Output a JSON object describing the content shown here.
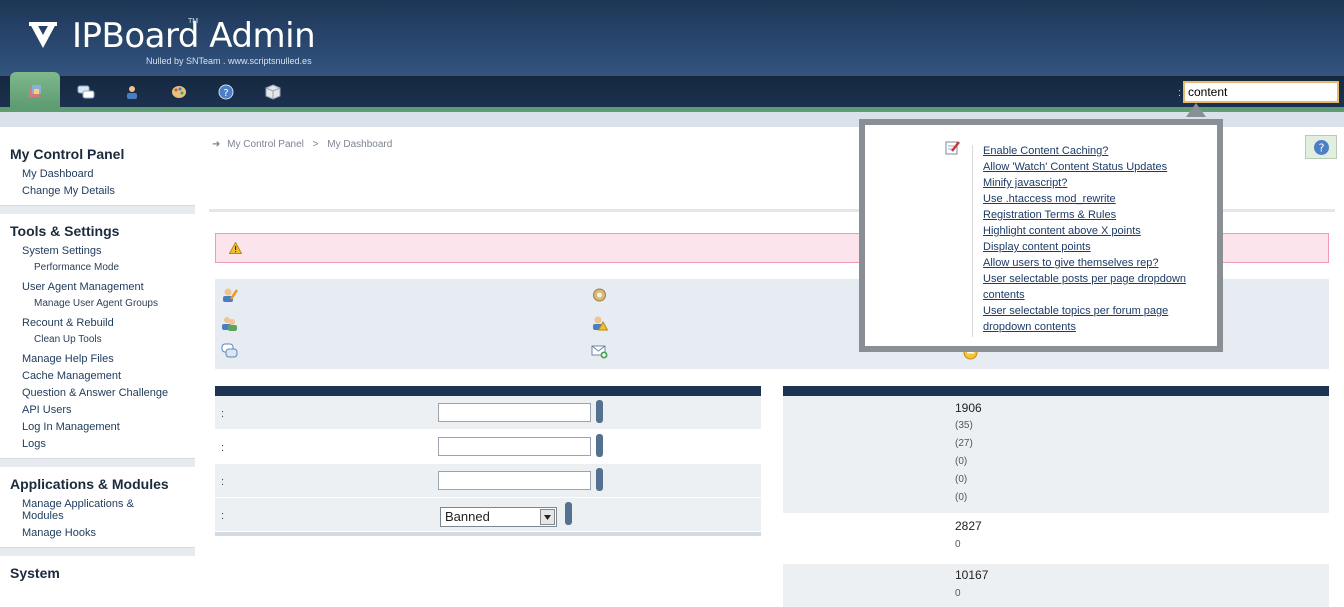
{
  "header": {
    "logo_text": "IPBoard Admin",
    "logo_tm": "TM",
    "logo_sub": "Nulled by SNTeam  .  www.scriptsnulled.es"
  },
  "nav": {
    "tabs": [
      {
        "icon": "home-icon"
      },
      {
        "icon": "chat-icon"
      },
      {
        "icon": "members-icon"
      },
      {
        "icon": "palette-icon"
      },
      {
        "icon": "help-icon"
      },
      {
        "icon": "package-icon"
      }
    ],
    "active_tab": 0
  },
  "search": {
    "colon": ":",
    "value": "content"
  },
  "sidebar": {
    "sections": [
      {
        "title": "My Control Panel",
        "items": [
          "My Dashboard",
          "Change My Details"
        ]
      },
      {
        "title": "Tools & Settings",
        "items": [
          "System Settings",
          "Performance Mode",
          "User Agent Management",
          "Manage User Agent Groups",
          "Recount & Rebuild",
          "Clean Up Tools",
          "Manage Help Files",
          "Cache Management",
          "Question & Answer Challenge",
          "API Users",
          "Log In Management",
          "Logs"
        ]
      },
      {
        "title": "Applications & Modules",
        "items": [
          "Manage Applications & Modules",
          "Manage Hooks"
        ]
      },
      {
        "title": "System",
        "items": []
      }
    ]
  },
  "breadcrumb": {
    "root": "My Control Panel",
    "separator": ">",
    "current": "My Dashboard"
  },
  "left_form": {
    "rows": [
      {
        "label": ":",
        "type": "text",
        "value": ""
      },
      {
        "label": ":",
        "type": "text",
        "value": ""
      },
      {
        "label": ":",
        "type": "text",
        "value": ""
      },
      {
        "label": ":",
        "type": "select",
        "value": "Banned"
      }
    ]
  },
  "stats": {
    "block1": {
      "main": "1906",
      "subs": [
        "(35)",
        "(27)",
        "(0)",
        "(0)",
        "(0)"
      ]
    },
    "block2": {
      "main": "2827",
      "subs": [
        "0"
      ]
    },
    "block3": {
      "main": "10167",
      "subs": [
        "0"
      ]
    }
  },
  "search_popup": {
    "results": [
      "Enable Content Caching?",
      "Allow 'Watch' Content Status Updates",
      "Minify javascript?",
      "Use .htaccess mod_rewrite",
      "Registration Terms & Rules",
      "Highlight content above X points",
      "Display content points",
      "Allow users to give themselves rep?",
      "User selectable posts per page dropdown contents",
      "User selectable topics per forum page dropdown contents"
    ]
  },
  "colors": {
    "header": "#2c4b74",
    "nav": "#1c3150",
    "accent_green": "#5e9c71",
    "alert_bg": "#fbe4ec",
    "alert_border": "#ef9bb2",
    "table_head": "#1e3352",
    "link": "#1e3c66"
  }
}
